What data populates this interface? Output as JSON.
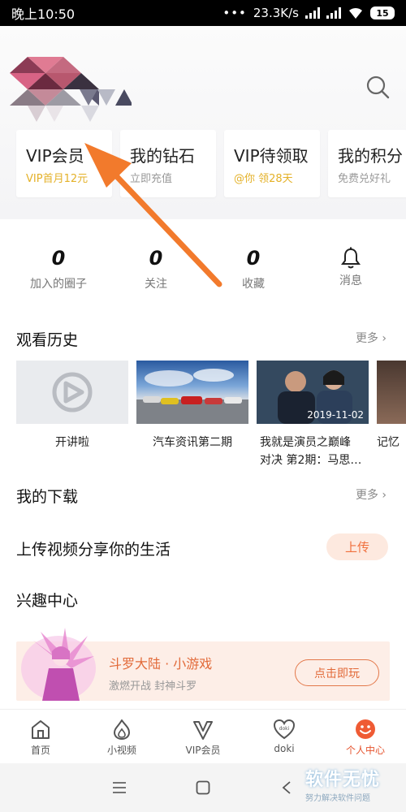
{
  "status_bar": {
    "time": "晚上10:50",
    "network_speed": "23.3K/s",
    "battery": "15"
  },
  "vip_cards": [
    {
      "title": "VIP会员",
      "subtitle": "VIP首月12元",
      "subtitle_color": "#e4b128"
    },
    {
      "title": "我的钻石",
      "subtitle": "立即充值",
      "subtitle_color": "#999999"
    },
    {
      "title": "VIP待领取",
      "subtitle": "@你 领28天",
      "subtitle_color": "#e4b128"
    },
    {
      "title": "我的积分",
      "subtitle": "免费兑好礼",
      "subtitle_color": "#999999"
    }
  ],
  "stats": [
    {
      "value": "0",
      "label": "加入的圈子"
    },
    {
      "value": "0",
      "label": "关注"
    },
    {
      "value": "0",
      "label": "收藏"
    },
    {
      "label": "消息",
      "icon": "bell-icon"
    }
  ],
  "history": {
    "title": "观看历史",
    "more": "更多",
    "items": [
      {
        "caption": "开讲啦"
      },
      {
        "caption": "汽车资讯第二期"
      },
      {
        "caption_line1": "我就是演员之巅峰",
        "caption_line2": "对决 第2期：马思…",
        "date": "2019-11-02"
      },
      {
        "caption": "记忆"
      }
    ]
  },
  "downloads": {
    "title": "我的下载",
    "more": "更多"
  },
  "upload": {
    "title": "上传视频分享你的生活",
    "button": "上传"
  },
  "interest": {
    "title": "兴趣中心",
    "game_title": "斗罗大陆 · 小游戏",
    "game_subtitle": "激燃开战 封神斗罗",
    "game_button": "点击即玩"
  },
  "tabs": [
    {
      "label": "首页",
      "icon": "home-icon"
    },
    {
      "label": "小视频",
      "icon": "flame-icon"
    },
    {
      "label": "VIP会员",
      "icon": "vip-icon"
    },
    {
      "label": "doki",
      "icon": "doki-heart-icon"
    },
    {
      "label": "个人中心",
      "icon": "smile-face-icon",
      "active": true
    }
  ],
  "watermark": {
    "line1": "软件无忧",
    "line2": "努力解决软件问题"
  },
  "colors": {
    "accent": "#e5542f",
    "gold": "#e4b128",
    "arrow": "#f27a2c"
  }
}
